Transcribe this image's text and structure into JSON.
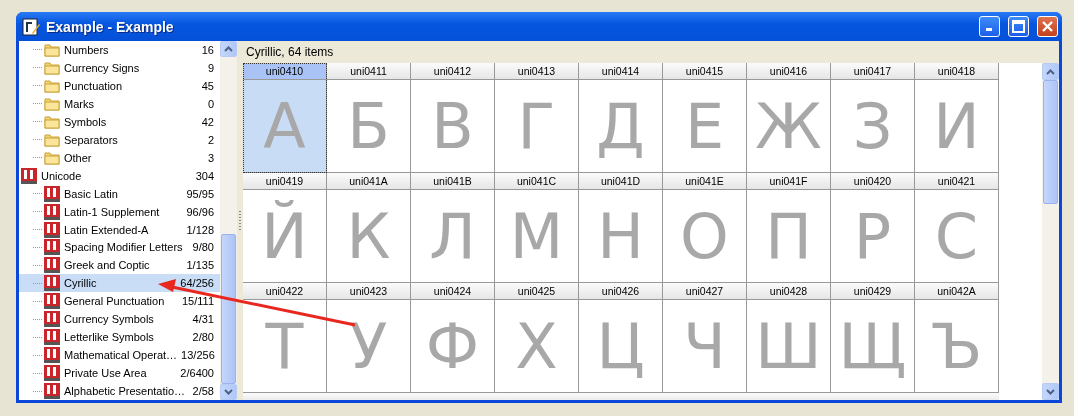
{
  "window": {
    "title": "Example - Example"
  },
  "tree": [
    {
      "children": [
        {
          "label": "Numbers",
          "count": "16",
          "kind": "folder",
          "selected": false
        },
        {
          "label": "Currency Signs",
          "count": "9",
          "kind": "folder",
          "selected": false
        },
        {
          "label": "Punctuation",
          "count": "45",
          "kind": "folder",
          "selected": false
        },
        {
          "label": "Marks",
          "count": "0",
          "kind": "folder",
          "selected": false
        },
        {
          "label": "Symbols",
          "count": "42",
          "kind": "folder",
          "selected": false
        },
        {
          "label": "Separators",
          "count": "2",
          "kind": "folder",
          "selected": false
        },
        {
          "label": "Other",
          "count": "3",
          "kind": "folder",
          "selected": false
        }
      ]
    },
    {
      "label": "Unicode",
      "count": "304",
      "kind": "unicode",
      "selected": false,
      "children": [
        {
          "label": "Basic Latin",
          "count": "95/95",
          "kind": "unicode",
          "selected": false
        },
        {
          "label": "Latin-1 Supplement",
          "count": "96/96",
          "kind": "unicode",
          "selected": false
        },
        {
          "label": "Latin Extended-A",
          "count": "1/128",
          "kind": "unicode",
          "selected": false
        },
        {
          "label": "Spacing Modifier Letters",
          "count": "9/80",
          "kind": "unicode",
          "selected": false
        },
        {
          "label": "Greek and Coptic",
          "count": "1/135",
          "kind": "unicode",
          "selected": false
        },
        {
          "label": "Cyrillic",
          "count": "64/256",
          "kind": "unicode",
          "selected": true
        },
        {
          "label": "General Punctuation",
          "count": "15/111",
          "kind": "unicode",
          "selected": false
        },
        {
          "label": "Currency Symbols",
          "count": "4/31",
          "kind": "unicode",
          "selected": false
        },
        {
          "label": "Letterlike Symbols",
          "count": "2/80",
          "kind": "unicode",
          "selected": false
        },
        {
          "label": "Mathematical Operat…",
          "count": "13/256",
          "kind": "unicode",
          "selected": false
        },
        {
          "label": "Private Use Area",
          "count": "2/6400",
          "kind": "unicode",
          "selected": false
        },
        {
          "label": "Alphabetic Presentatio…",
          "count": "2/58",
          "kind": "unicode",
          "selected": false
        }
      ]
    }
  ],
  "grid": {
    "title": "Cyrillic, 64 items",
    "cells": [
      {
        "code": "uni0410",
        "glyph": "А",
        "selected": true
      },
      {
        "code": "uni0411",
        "glyph": "Б",
        "selected": false
      },
      {
        "code": "uni0412",
        "glyph": "В",
        "selected": false
      },
      {
        "code": "uni0413",
        "glyph": "Г",
        "selected": false
      },
      {
        "code": "uni0414",
        "glyph": "Д",
        "selected": false
      },
      {
        "code": "uni0415",
        "glyph": "Е",
        "selected": false
      },
      {
        "code": "uni0416",
        "glyph": "Ж",
        "selected": false
      },
      {
        "code": "uni0417",
        "glyph": "З",
        "selected": false
      },
      {
        "code": "uni0418",
        "glyph": "И",
        "selected": false
      },
      {
        "code": "uni0419",
        "glyph": "Й",
        "selected": false
      },
      {
        "code": "uni041A",
        "glyph": "К",
        "selected": false
      },
      {
        "code": "uni041B",
        "glyph": "Л",
        "selected": false
      },
      {
        "code": "uni041C",
        "glyph": "М",
        "selected": false
      },
      {
        "code": "uni041D",
        "glyph": "Н",
        "selected": false
      },
      {
        "code": "uni041E",
        "glyph": "О",
        "selected": false
      },
      {
        "code": "uni041F",
        "glyph": "П",
        "selected": false
      },
      {
        "code": "uni0420",
        "glyph": "Р",
        "selected": false
      },
      {
        "code": "uni0421",
        "glyph": "С",
        "selected": false
      },
      {
        "code": "uni0422",
        "glyph": "Т",
        "selected": false
      },
      {
        "code": "uni0423",
        "glyph": "У",
        "selected": false
      },
      {
        "code": "uni0424",
        "glyph": "Ф",
        "selected": false
      },
      {
        "code": "uni0425",
        "glyph": "Х",
        "selected": false
      },
      {
        "code": "uni0426",
        "glyph": "Ц",
        "selected": false
      },
      {
        "code": "uni0427",
        "glyph": "Ч",
        "selected": false
      },
      {
        "code": "uni0428",
        "glyph": "Ш",
        "selected": false
      },
      {
        "code": "uni0429",
        "glyph": "Щ",
        "selected": false
      },
      {
        "code": "uni042A",
        "glyph": "Ъ",
        "selected": false
      }
    ]
  }
}
